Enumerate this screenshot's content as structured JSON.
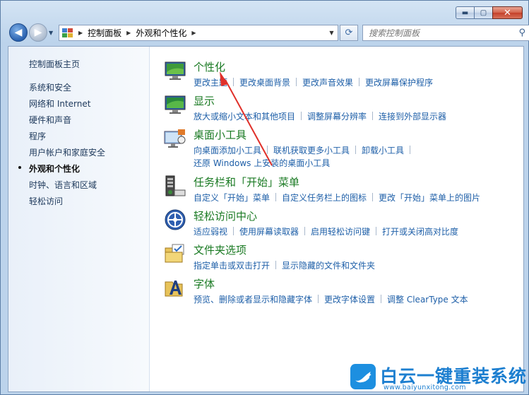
{
  "window": {
    "caption": {
      "minimize": "▬",
      "maximize": "▢",
      "close": "✕"
    }
  },
  "nav": {
    "back": "◀",
    "forward": "▶",
    "dropdown": "▼",
    "breadcrumb": [
      "控制面板",
      "外观和个性化"
    ],
    "crumb_separator": "▶",
    "address_dropdown": "▼",
    "refresh": "⟳",
    "search_placeholder": "搜索控制面板",
    "search_icon": "⚲"
  },
  "sidebar": {
    "items": [
      {
        "label": "控制面板主页",
        "current": false
      },
      {
        "label": "系统和安全",
        "current": false
      },
      {
        "label": "网络和 Internet",
        "current": false
      },
      {
        "label": "硬件和声音",
        "current": false
      },
      {
        "label": "程序",
        "current": false
      },
      {
        "label": "用户帐户和家庭安全",
        "current": false
      },
      {
        "label": "外观和个性化",
        "current": true
      },
      {
        "label": "时钟、语言和区域",
        "current": false
      },
      {
        "label": "轻松访问",
        "current": false
      }
    ]
  },
  "categories": [
    {
      "title": "个性化",
      "icon": "personalization-icon",
      "links": [
        [
          "更改主题",
          "更改桌面背景",
          "更改声音效果",
          "更改屏幕保护程序"
        ]
      ]
    },
    {
      "title": "显示",
      "icon": "display-icon",
      "links": [
        [
          "放大或缩小文本和其他项目",
          "调整屏幕分辨率",
          "连接到外部显示器"
        ]
      ]
    },
    {
      "title": "桌面小工具",
      "icon": "gadgets-icon",
      "links": [
        [
          "向桌面添加小工具",
          "联机获取更多小工具",
          "卸载小工具"
        ],
        [
          "还原 Windows 上安装的桌面小工具"
        ]
      ]
    },
    {
      "title": "任务栏和「开始」菜单",
      "icon": "taskbar-icon",
      "links": [
        [
          "自定义「开始」菜单",
          "自定义任务栏上的图标",
          "更改「开始」菜单上的图片"
        ]
      ]
    },
    {
      "title": "轻松访问中心",
      "icon": "ease-of-access-icon",
      "links": [
        [
          "适应弱视",
          "使用屏幕读取器",
          "启用轻松访问键",
          "打开或关闭高对比度"
        ]
      ]
    },
    {
      "title": "文件夹选项",
      "icon": "folder-options-icon",
      "links": [
        [
          "指定单击或双击打开",
          "显示隐藏的文件和文件夹"
        ]
      ]
    },
    {
      "title": "字体",
      "icon": "fonts-icon",
      "links": [
        [
          "预览、删除或者显示和隐藏字体",
          "更改字体设置",
          "调整 ClearType 文本"
        ]
      ]
    }
  ],
  "watermark": {
    "title": "白云一键重装系统",
    "url": "www.baiyunxitong.com"
  },
  "colors": {
    "link": "#1e5fa8",
    "category_title": "#1a7a23",
    "annotation_arrow": "#e0302a",
    "watermark": "#1d7fd0"
  }
}
